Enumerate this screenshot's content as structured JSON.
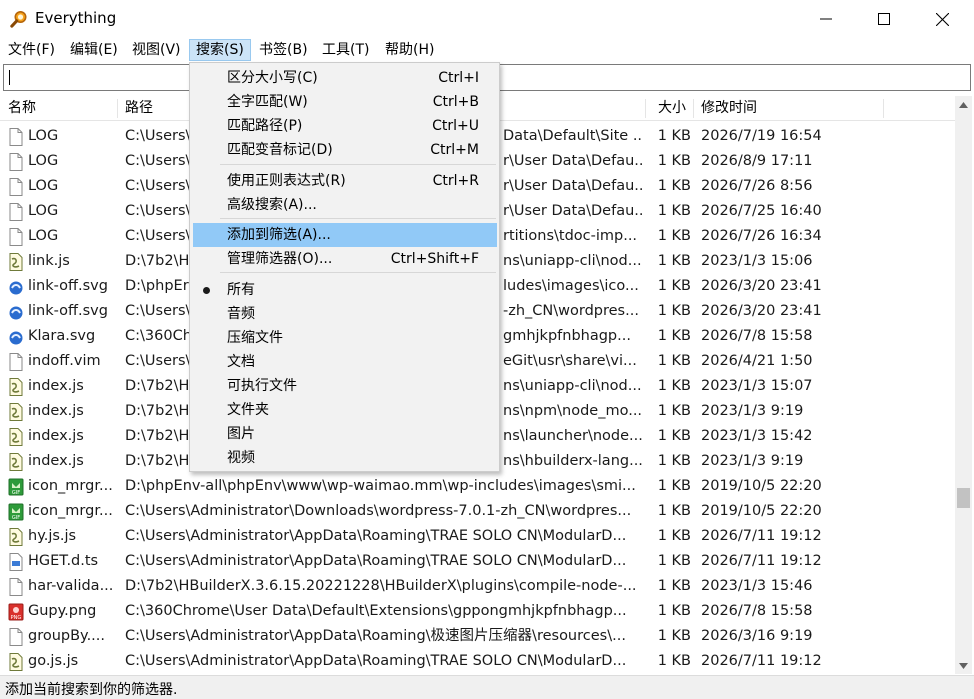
{
  "window": {
    "title": "Everything",
    "accent_color": "#cce4f7",
    "highlight_color": "#91c9f7"
  },
  "menubar": {
    "items": [
      "文件(F)",
      "编辑(E)",
      "视图(V)",
      "搜索(S)",
      "书签(B)",
      "工具(T)",
      "帮助(H)"
    ],
    "active_index": 3
  },
  "search": {
    "value": "",
    "placeholder": ""
  },
  "columns": {
    "name": "名称",
    "path": "路径",
    "size": "大小",
    "modified": "修改时间"
  },
  "files": [
    {
      "name": "LOG",
      "icon": "text-file-icon",
      "path": "C:\\Users\\",
      "path_tail": "Data\\Default\\Site ...",
      "size": "1 KB",
      "modified": "2026/7/19 16:54"
    },
    {
      "name": "LOG",
      "icon": "text-file-icon",
      "path": "C:\\Users\\",
      "path_tail": "r\\User Data\\Defau...",
      "size": "1 KB",
      "modified": "2026/8/9 17:11"
    },
    {
      "name": "LOG",
      "icon": "text-file-icon",
      "path": "C:\\Users\\",
      "path_tail": "r\\User Data\\Defau...",
      "size": "1 KB",
      "modified": "2026/7/26 8:56"
    },
    {
      "name": "LOG",
      "icon": "text-file-icon",
      "path": "C:\\Users\\",
      "path_tail": "r\\User Data\\Defau...",
      "size": "1 KB",
      "modified": "2026/7/25 16:40"
    },
    {
      "name": "LOG",
      "icon": "text-file-icon",
      "path": "C:\\Users\\",
      "path_tail": "rtitions\\tdoc-imp...",
      "size": "1 KB",
      "modified": "2026/7/26 16:34"
    },
    {
      "name": "link.js",
      "icon": "js-file-icon",
      "path": "D:\\7b2\\H",
      "path_tail": "ns\\uniapp-cli\\nod...",
      "size": "1 KB",
      "modified": "2023/1/3 15:06"
    },
    {
      "name": "link-off.svg",
      "icon": "svg-file-icon",
      "path": "D:\\phpEr",
      "path_tail": "ludes\\images\\ico...",
      "size": "1 KB",
      "modified": "2026/3/20 23:41"
    },
    {
      "name": "link-off.svg",
      "icon": "svg-file-icon",
      "path": "C:\\Users\\",
      "path_tail": "-zh_CN\\wordpres...",
      "size": "1 KB",
      "modified": "2026/3/20 23:41"
    },
    {
      "name": "Klara.svg",
      "icon": "svg-file-icon",
      "path": "C:\\360Ch",
      "path_tail": "gmhjkpfnbhagp...",
      "size": "1 KB",
      "modified": "2026/7/8 15:58"
    },
    {
      "name": "indoff.vim",
      "icon": "text-file-icon",
      "path": "C:\\Users\\",
      "path_tail": "eGit\\usr\\share\\vi...",
      "size": "1 KB",
      "modified": "2026/4/21 1:50"
    },
    {
      "name": "index.js",
      "icon": "js-file-icon",
      "path": "D:\\7b2\\H",
      "path_tail": "ns\\uniapp-cli\\nod...",
      "size": "1 KB",
      "modified": "2023/1/3 15:07"
    },
    {
      "name": "index.js",
      "icon": "js-file-icon",
      "path": "D:\\7b2\\H",
      "path_tail": "ns\\npm\\node_mo...",
      "size": "1 KB",
      "modified": "2023/1/3 9:19"
    },
    {
      "name": "index.js",
      "icon": "js-file-icon",
      "path": "D:\\7b2\\H",
      "path_tail": "ns\\launcher\\node...",
      "size": "1 KB",
      "modified": "2023/1/3 15:42"
    },
    {
      "name": "index.js",
      "icon": "js-file-icon",
      "path": "D:\\7b2\\H",
      "path_tail": "ns\\hbuilderx-lang...",
      "size": "1 KB",
      "modified": "2023/1/3 9:19"
    },
    {
      "name": "icon_mrgr...",
      "icon": "gif-file-icon",
      "path": "D:\\phpEnv-all\\phpEnv\\www\\wp-waimao.mm\\wp-includes\\images\\smi...",
      "path_tail": "",
      "size": "1 KB",
      "modified": "2019/10/5 22:20"
    },
    {
      "name": "icon_mrgr...",
      "icon": "gif-file-icon",
      "path": "C:\\Users\\Administrator\\Downloads\\wordpress-7.0.1-zh_CN\\wordpres...",
      "path_tail": "",
      "size": "1 KB",
      "modified": "2019/10/5 22:20"
    },
    {
      "name": "hy.js.js",
      "icon": "js-file-icon",
      "path": "C:\\Users\\Administrator\\AppData\\Roaming\\TRAE SOLO CN\\ModularD...",
      "path_tail": "",
      "size": "1 KB",
      "modified": "2026/7/11 19:12"
    },
    {
      "name": "HGET.d.ts",
      "icon": "ts-file-icon",
      "path": "C:\\Users\\Administrator\\AppData\\Roaming\\TRAE SOLO CN\\ModularD...",
      "path_tail": "",
      "size": "1 KB",
      "modified": "2026/7/11 19:12"
    },
    {
      "name": "har-valida...",
      "icon": "text-file-icon",
      "path": "D:\\7b2\\HBuilderX.3.6.15.20221228\\HBuilderX\\plugins\\compile-node-...",
      "path_tail": "",
      "size": "1 KB",
      "modified": "2023/1/3 15:46"
    },
    {
      "name": "Gupy.png",
      "icon": "png-file-icon",
      "path": "C:\\360Chrome\\User Data\\Default\\Extensions\\gppongmhjkpfnbhagp...",
      "path_tail": "",
      "size": "1 KB",
      "modified": "2026/7/8 15:58"
    },
    {
      "name": "groupBy....",
      "icon": "text-file-icon",
      "path": "C:\\Users\\Administrator\\AppData\\Roaming\\极速图片压缩器\\resources\\...",
      "path_tail": "",
      "size": "1 KB",
      "modified": "2026/3/16 9:19"
    },
    {
      "name": "go.js.js",
      "icon": "js-file-icon",
      "path": "C:\\Users\\Administrator\\AppData\\Roaming\\TRAE SOLO CN\\ModularD...",
      "path_tail": "",
      "size": "1 KB",
      "modified": "2026/7/11 19:12"
    }
  ],
  "search_menu": {
    "items": [
      {
        "label": "区分大小写(C)",
        "shortcut": "Ctrl+I"
      },
      {
        "label": "全字匹配(W)",
        "shortcut": "Ctrl+B"
      },
      {
        "label": "匹配路径(P)",
        "shortcut": "Ctrl+U"
      },
      {
        "label": "匹配变音标记(D)",
        "shortcut": "Ctrl+M"
      },
      {
        "label": "使用正则表达式(R)",
        "shortcut": "Ctrl+R"
      },
      {
        "label": "高级搜索(A)...",
        "shortcut": ""
      },
      {
        "label": "添加到筛选(A)...",
        "shortcut": "",
        "highlighted": true
      },
      {
        "label": "管理筛选器(O)...",
        "shortcut": "Ctrl+Shift+F"
      },
      {
        "label": "所有",
        "shortcut": "",
        "checked": true
      },
      {
        "label": "音频",
        "shortcut": ""
      },
      {
        "label": "压缩文件",
        "shortcut": ""
      },
      {
        "label": "文档",
        "shortcut": ""
      },
      {
        "label": "可执行文件",
        "shortcut": ""
      },
      {
        "label": "文件夹",
        "shortcut": ""
      },
      {
        "label": "图片",
        "shortcut": ""
      },
      {
        "label": "视频",
        "shortcut": ""
      }
    ]
  },
  "status": {
    "text": "添加当前搜索到你的筛选器."
  }
}
